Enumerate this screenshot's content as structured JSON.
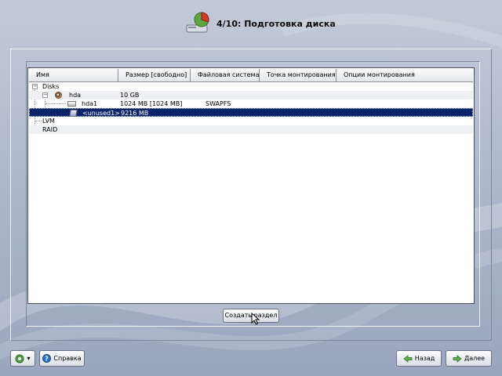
{
  "header": {
    "title": "4/10: Подготовка диска"
  },
  "table": {
    "columns": [
      "Имя",
      "Размер [свободно]",
      "Файловая система",
      "Точка монтирования",
      "Опции монтирования"
    ],
    "rows": [
      {
        "name": "Disks",
        "size": "",
        "fs": ""
      },
      {
        "name": "hda",
        "size": "10 GB",
        "fs": ""
      },
      {
        "name": "hda1",
        "size": "1024 MB [1024 MB]",
        "fs": "SWAPFS"
      },
      {
        "name": "<unused1>",
        "size": "9216 MB",
        "fs": ""
      },
      {
        "name": "LVM",
        "size": "",
        "fs": ""
      },
      {
        "name": "RAID",
        "size": "",
        "fs": ""
      }
    ]
  },
  "buttons": {
    "create_partition": "Создать раздел",
    "help": "Справка",
    "back": "Назад",
    "next": "Далее"
  },
  "colors": {
    "selection": "#0a246a",
    "background": "#aeb9cc"
  },
  "icons": {
    "header": "disk-pie-icon",
    "menu": "green-circle-menu-icon",
    "help": "help-icon",
    "back": "arrow-left-icon",
    "next": "arrow-right-icon"
  }
}
